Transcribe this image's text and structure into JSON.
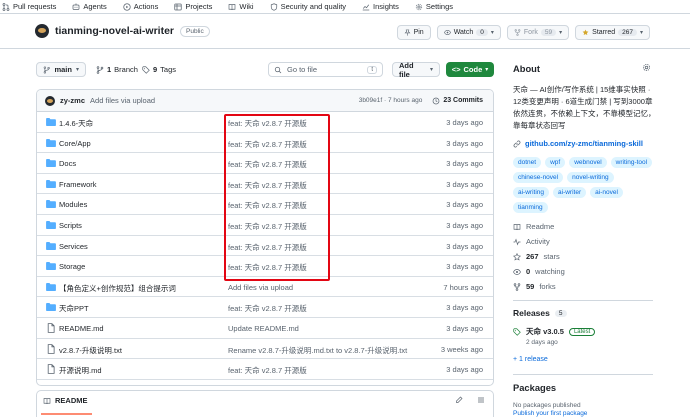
{
  "nav": {
    "pull_requests": "Pull requests",
    "agents": "Agents",
    "actions": "Actions",
    "projects": "Projects",
    "wiki": "Wiki",
    "security": "Security and quality",
    "insights": "Insights",
    "settings": "Settings",
    "security_count": "",
    "active_tab_color": "#fd8c73"
  },
  "repo": {
    "name": "tianming-novel-ai-writer",
    "visibility": "Public",
    "pin": "Pin",
    "watch": "Watch",
    "watch_count": "0",
    "fork": "Fork",
    "fork_count": "59",
    "starred": "Starred",
    "star_count": "267"
  },
  "branchbar": {
    "branch": "main",
    "branches": "1",
    "branches_label": "Branch",
    "tags": "9",
    "tags_label": "Tags",
    "goto_placeholder": "Go to file",
    "goto_kbd": "t",
    "add_file": "Add file",
    "code": "Code",
    "code_color": "#1f883d"
  },
  "commit": {
    "author": "zy-zmc",
    "message": "Add files via upload",
    "hash_time": "3b09e1f · 7 hours ago",
    "commits": "23 Commits"
  },
  "files": [
    {
      "name": "1.4.6-天命",
      "type": "folder",
      "message": "feat: 天命 v2.8.7 开源版",
      "age": "3 days ago"
    },
    {
      "name": "Core/App",
      "type": "folder",
      "message": "feat: 天命 v2.8.7 开源版",
      "age": "3 days ago"
    },
    {
      "name": "Docs",
      "type": "folder",
      "message": "feat: 天命 v2.8.7 开源版",
      "age": "3 days ago"
    },
    {
      "name": "Framework",
      "type": "folder",
      "message": "feat: 天命 v2.8.7 开源版",
      "age": "3 days ago"
    },
    {
      "name": "Modules",
      "type": "folder",
      "message": "feat: 天命 v2.8.7 开源版",
      "age": "3 days ago"
    },
    {
      "name": "Scripts",
      "type": "folder",
      "message": "feat: 天命 v2.8.7 开源版",
      "age": "3 days ago"
    },
    {
      "name": "Services",
      "type": "folder",
      "message": "feat: 天命 v2.8.7 开源版",
      "age": "3 days ago"
    },
    {
      "name": "Storage",
      "type": "folder",
      "message": "feat: 天命 v2.8.7 开源版",
      "age": "3 days ago"
    },
    {
      "name": "【角色定义+创作规范】组合提示词",
      "type": "folder",
      "message": "Add files via upload",
      "age": "7 hours ago"
    },
    {
      "name": "天命PPT",
      "type": "folder",
      "message": "feat: 天命 v2.8.7 开源版",
      "age": "3 days ago"
    },
    {
      "name": "README.md",
      "type": "file",
      "message": "Update README.md",
      "age": "3 days ago"
    },
    {
      "name": "v2.8.7-升级说明.txt",
      "type": "file",
      "message": "Rename v2.8.7-升级说明.md.txt to v2.8.7-升级说明.txt",
      "age": "3 weeks ago"
    },
    {
      "name": "开源说明.md",
      "type": "file",
      "message": "feat: 天命 v2.8.7 开源版",
      "age": "3 days ago"
    }
  ],
  "readme": {
    "tab": "README"
  },
  "about": {
    "title": "About",
    "description": "天命 — AI创作/写作系统 | 15维事实快照 · 12类变更声明 · 6道生成门禁 | 写到3000章依然连贯，不依赖上下文，不靠模型记忆，靠每章状态回写",
    "link": "github.com/zy-zmc/tianming-skill",
    "topics": [
      "dotnet",
      "wpf",
      "webnovel",
      "writing-tool",
      "chinese-novel",
      "novel-writing",
      "ai-writing",
      "ai-writer",
      "ai-novel",
      "tianming"
    ],
    "readme": "Readme",
    "activity": "Activity",
    "stars": "267",
    "stars_label": "stars",
    "watching": "0",
    "watching_label": "watching",
    "forks": "59",
    "forks_label": "forks"
  },
  "releases": {
    "title": "Releases",
    "count": "5",
    "latest_name": "天命 v3.0.5",
    "latest_badge": "Latest",
    "latest_date": "2 days ago",
    "more": "+ 1 release"
  },
  "packages": {
    "title": "Packages",
    "none": "No packages published",
    "publish": "Publish your first package"
  },
  "highlight_color": "#e30613"
}
